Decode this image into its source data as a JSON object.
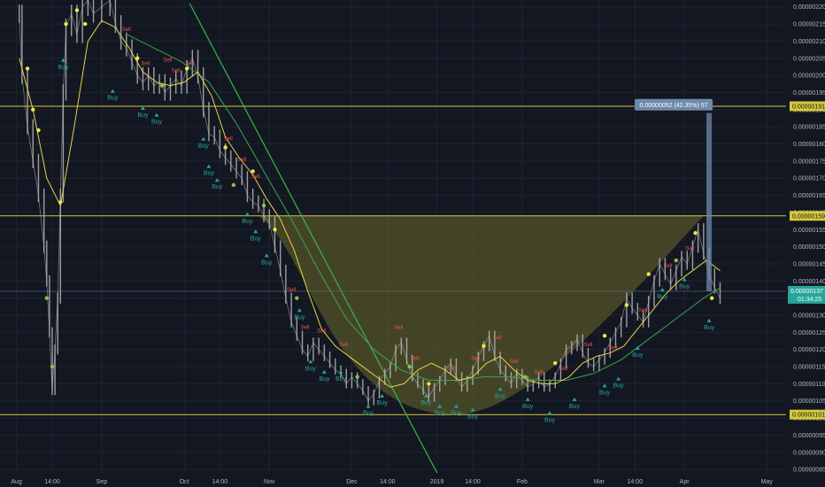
{
  "chart_data": {
    "type": "line",
    "price_axis": {
      "labels": [
        "0.00000220",
        "0.00000215",
        "0.00000210",
        "0.00000205",
        "0.00000200",
        "0.00000195",
        "0.00000190",
        "0.00000185",
        "0.00000180",
        "0.00000175",
        "0.00000170",
        "0.00000165",
        "0.00000160",
        "0.00000155",
        "0.00000150",
        "0.00000145",
        "0.00000140",
        "0.00000135",
        "0.00000130",
        "0.00000125",
        "0.00000120",
        "0.00000115",
        "0.00000110",
        "0.00000105",
        "0.00000100",
        "0.00000095",
        "0.00000090",
        "0.00000085"
      ],
      "ylim": [
        8.4e-07,
        2.22e-06
      ]
    },
    "time_axis": {
      "ticks": [
        {
          "day": 0,
          "label": "Aug"
        },
        {
          "day": 13,
          "label": "14:00"
        },
        {
          "day": 31,
          "label": "Sep"
        },
        {
          "day": 61,
          "label": "Oct"
        },
        {
          "day": 74,
          "label": "14:00"
        },
        {
          "day": 92,
          "label": "Nov"
        },
        {
          "day": 122,
          "label": "Dec"
        },
        {
          "day": 135,
          "label": "14:00"
        },
        {
          "day": 153,
          "label": "2019"
        },
        {
          "day": 166,
          "label": "14:00"
        },
        {
          "day": 184,
          "label": "Feb"
        },
        {
          "day": 212,
          "label": "Mar"
        },
        {
          "day": 225,
          "label": "14:00"
        },
        {
          "day": 243,
          "label": "Apr"
        },
        {
          "day": 273,
          "label": "May"
        }
      ]
    },
    "price_series": {
      "name": "",
      "x": [
        1,
        2,
        4,
        6,
        8,
        10,
        11,
        12,
        13,
        14,
        15,
        16,
        17,
        18,
        20,
        22,
        24,
        26,
        28,
        31,
        34,
        36,
        38,
        40,
        42,
        44,
        46,
        48,
        50,
        52,
        54,
        56,
        58,
        60,
        62,
        64,
        66,
        68,
        70,
        72,
        74,
        76,
        78,
        80,
        82,
        84,
        86,
        88,
        90,
        92,
        94,
        96,
        98,
        100,
        102,
        104,
        106,
        108,
        110,
        112,
        114,
        116,
        118,
        120,
        122,
        124,
        126,
        128,
        130,
        132,
        134,
        136,
        138,
        140,
        142,
        144,
        146,
        148,
        150,
        152,
        154,
        156,
        158,
        160,
        162,
        164,
        166,
        168,
        170,
        172,
        174,
        176,
        178,
        180,
        182,
        184,
        186,
        188,
        190,
        192,
        194,
        196,
        198,
        200,
        202,
        204,
        206,
        208,
        210,
        212,
        214,
        216,
        218,
        220,
        222,
        224,
        226,
        228,
        230,
        232,
        234,
        236,
        238,
        240,
        242,
        244,
        246,
        248,
        250,
        252,
        254,
        256
      ],
      "y": [
        2.18e-06,
        2e-06,
        1.85e-06,
        1.75e-06,
        1.65e-06,
        1.5e-06,
        1.4e-06,
        1.25e-06,
        1.08e-06,
        1.2e-06,
        1.35e-06,
        1.65e-06,
        1.95e-06,
        2.14e-06,
        2.18e-06,
        2.12e-06,
        2.2e-06,
        2.22e-06,
        2.18e-06,
        2.2e-06,
        2.22e-06,
        2.15e-06,
        2.1e-06,
        2.08e-06,
        2.04e-06,
        2e-06,
        1.98e-06,
        2e-06,
        1.97e-06,
        1.98e-06,
        1.95e-06,
        1.97e-06,
        1.99e-06,
        1.97e-06,
        2.02e-06,
        2.05e-06,
        2e-06,
        1.9e-06,
        1.83e-06,
        1.82e-06,
        1.78e-06,
        1.76e-06,
        1.74e-06,
        1.72e-06,
        1.7e-06,
        1.65e-06,
        1.63e-06,
        1.62e-06,
        1.59e-06,
        1.57e-06,
        1.5e-06,
        1.43e-06,
        1.35e-06,
        1.28e-06,
        1.24e-06,
        1.2e-06,
        1.18e-06,
        1.22e-06,
        1.2e-06,
        1.18e-06,
        1.16e-06,
        1.14e-06,
        1.13e-06,
        1.1e-06,
        1.12e-06,
        1.1e-06,
        1.08e-06,
        1.05e-06,
        1.07e-06,
        1.11e-06,
        1.13e-06,
        1.15e-06,
        1.2e-06,
        1.22e-06,
        1.17e-06,
        1.12e-06,
        1.1e-06,
        1.08e-06,
        1.06e-06,
        1.09e-06,
        1.11e-06,
        1.14e-06,
        1.16e-06,
        1.12e-06,
        1.09e-06,
        1.11e-06,
        1.14e-06,
        1.18e-06,
        1.21e-06,
        1.24e-06,
        1.18e-06,
        1.14e-06,
        1.12e-06,
        1.1e-06,
        1.13e-06,
        1.11e-06,
        1.09e-06,
        1.1e-06,
        1.12e-06,
        1.09e-06,
        1.1e-06,
        1.12e-06,
        1.16e-06,
        1.2e-06,
        1.21e-06,
        1.23e-06,
        1.19e-06,
        1.16e-06,
        1.15e-06,
        1.17e-06,
        1.19e-06,
        1.22e-06,
        1.25e-06,
        1.28e-06,
        1.35e-06,
        1.32e-06,
        1.3e-06,
        1.28e-06,
        1.34e-06,
        1.4e-06,
        1.45e-06,
        1.42e-06,
        1.39e-06,
        1.43e-06,
        1.47e-06,
        1.45e-06,
        1.5e-06,
        1.55e-06,
        1.48e-06,
        1.42e-06,
        1.38e-06,
        1.35e-06,
        1.32e-06
      ]
    },
    "ma_fast": {
      "name": "",
      "color": "#e8d24a",
      "x": [
        1,
        6,
        11,
        16,
        21,
        26,
        31,
        36,
        41,
        46,
        51,
        56,
        61,
        66,
        71,
        76,
        81,
        86,
        91,
        96,
        101,
        106,
        111,
        116,
        121,
        126,
        131,
        136,
        141,
        146,
        151,
        156,
        161,
        166,
        171,
        176,
        181,
        186,
        191,
        196,
        201,
        206,
        211,
        216,
        221,
        226,
        231,
        236,
        241,
        246,
        251,
        256
      ],
      "y": [
        2.05e-06,
        1.9e-06,
        1.7e-06,
        1.62e-06,
        1.85e-06,
        2.1e-06,
        2.16e-06,
        2.14e-06,
        2.08e-06,
        2.01e-06,
        1.98e-06,
        1.97e-06,
        1.98e-06,
        2.01e-06,
        1.94e-06,
        1.82e-06,
        1.76e-06,
        1.71e-06,
        1.64e-06,
        1.58e-06,
        1.49e-06,
        1.37e-06,
        1.26e-06,
        1.21e-06,
        1.18e-06,
        1.15e-06,
        1.12e-06,
        1.09e-06,
        1.1e-06,
        1.14e-06,
        1.16e-06,
        1.14e-06,
        1.11e-06,
        1.12e-06,
        1.16e-06,
        1.18e-06,
        1.14e-06,
        1.11e-06,
        1.1e-06,
        1.1e-06,
        1.12e-06,
        1.16e-06,
        1.18e-06,
        1.19e-06,
        1.21e-06,
        1.26e-06,
        1.31e-06,
        1.36e-06,
        1.4e-06,
        1.43e-06,
        1.46e-06,
        1.43e-06
      ]
    },
    "ma_slow": {
      "name": "",
      "color": "#3fa34d",
      "x": [
        40,
        50,
        60,
        70,
        80,
        90,
        100,
        110,
        120,
        130,
        140,
        150,
        160,
        170,
        180,
        190,
        200,
        210,
        220,
        230,
        240,
        250,
        256
      ],
      "y": [
        2.12e-06,
        2.08e-06,
        2.04e-06,
        1.98e-06,
        1.86e-06,
        1.72e-06,
        1.58e-06,
        1.43e-06,
        1.29e-06,
        1.2e-06,
        1.14e-06,
        1.11e-06,
        1.11e-06,
        1.12e-06,
        1.12e-06,
        1.11e-06,
        1.11e-06,
        1.13e-06,
        1.17e-06,
        1.23e-06,
        1.29e-06,
        1.35e-06,
        1.38e-06
      ]
    },
    "trendline": {
      "color": "#3bb54a",
      "points": [
        {
          "x": 63,
          "y": 2.21e-06
        },
        {
          "x": 153,
          "y": 8.4e-07
        }
      ]
    },
    "horizontal_levels": [
      {
        "value": 1.91e-06,
        "label": "0.00000191",
        "color": "#d4c93a"
      },
      {
        "value": 1.59e-06,
        "label": "0.00000159",
        "color": "#d4c93a"
      },
      {
        "value": 1.01e-06,
        "label": "0.00000101",
        "color": "#d4c93a"
      }
    ],
    "current_price": {
      "value": 1.37e-06,
      "label": "0.00000137",
      "sub_label": "01:34:25",
      "color": "#26a69a"
    },
    "reference_line": {
      "value": 1.37e-06,
      "color": "#5d6b7a"
    },
    "cup_pattern": {
      "fill_color": "#6b6a2a",
      "rim": 1.59e-06,
      "bottom": 1.01e-06,
      "x_start": 88,
      "x_bottom": 160,
      "x_end": 250
    },
    "measure_tool": {
      "label": "0.00000052 (42.35%) 57",
      "from": 1.37e-06,
      "to": 1.89e-06,
      "x": 252,
      "color": "#6e8aa8"
    },
    "signals": {
      "buy_label": "Buy",
      "sell_label": "Sell",
      "buy": [
        {
          "x": 17,
          "y": 2.05e-06
        },
        {
          "x": 35,
          "y": 1.96e-06
        },
        {
          "x": 46,
          "y": 1.91e-06
        },
        {
          "x": 51,
          "y": 1.89e-06
        },
        {
          "x": 68,
          "y": 1.82e-06
        },
        {
          "x": 70,
          "y": 1.74e-06
        },
        {
          "x": 73,
          "y": 1.7e-06
        },
        {
          "x": 84,
          "y": 1.6e-06
        },
        {
          "x": 87,
          "y": 1.55e-06
        },
        {
          "x": 91,
          "y": 1.48e-06
        },
        {
          "x": 103,
          "y": 1.32e-06
        },
        {
          "x": 107,
          "y": 1.17e-06
        },
        {
          "x": 112,
          "y": 1.14e-06
        },
        {
          "x": 118,
          "y": 1.14e-06
        },
        {
          "x": 128,
          "y": 1.04e-06
        },
        {
          "x": 133,
          "y": 1.07e-06
        },
        {
          "x": 149,
          "y": 1.07e-06
        },
        {
          "x": 154,
          "y": 1.04e-06
        },
        {
          "x": 160,
          "y": 1.04e-06
        },
        {
          "x": 166,
          "y": 1.03e-06
        },
        {
          "x": 176,
          "y": 1.09e-06
        },
        {
          "x": 186,
          "y": 1.06e-06
        },
        {
          "x": 194,
          "y": 1.02e-06
        },
        {
          "x": 203,
          "y": 1.06e-06
        },
        {
          "x": 214,
          "y": 1.1e-06
        },
        {
          "x": 219,
          "y": 1.12e-06
        },
        {
          "x": 226,
          "y": 1.21e-06
        },
        {
          "x": 235,
          "y": 1.38e-06
        },
        {
          "x": 243,
          "y": 1.41e-06
        },
        {
          "x": 252,
          "y": 1.29e-06
        }
      ],
      "sell": [
        {
          "x": 27,
          "y": 2.23e-06
        },
        {
          "x": 40,
          "y": 2.13e-06
        },
        {
          "x": 47,
          "y": 2.03e-06
        },
        {
          "x": 55,
          "y": 2.04e-06
        },
        {
          "x": 58,
          "y": 2.01e-06
        },
        {
          "x": 63,
          "y": 2.03e-06
        },
        {
          "x": 77,
          "y": 1.81e-06
        },
        {
          "x": 82,
          "y": 1.75e-06
        },
        {
          "x": 87,
          "y": 1.7e-06
        },
        {
          "x": 100,
          "y": 1.37e-06
        },
        {
          "x": 105,
          "y": 1.26e-06
        },
        {
          "x": 111,
          "y": 1.25e-06
        },
        {
          "x": 119,
          "y": 1.21e-06
        },
        {
          "x": 139,
          "y": 1.26e-06
        },
        {
          "x": 145,
          "y": 1.17e-06
        },
        {
          "x": 158,
          "y": 1.14e-06
        },
        {
          "x": 167,
          "y": 1.17e-06
        },
        {
          "x": 175,
          "y": 1.23e-06
        },
        {
          "x": 181,
          "y": 1.16e-06
        },
        {
          "x": 190,
          "y": 1.13e-06
        },
        {
          "x": 199,
          "y": 1.14e-06
        },
        {
          "x": 208,
          "y": 1.21e-06
        },
        {
          "x": 217,
          "y": 1.2e-06
        },
        {
          "x": 228,
          "y": 1.31e-06
        },
        {
          "x": 237,
          "y": 1.44e-06
        },
        {
          "x": 245,
          "y": 1.49e-06
        }
      ],
      "dots": [
        {
          "x": 4,
          "y": 2.02e-06,
          "color": "#e8e84a"
        },
        {
          "x": 6,
          "y": 1.9e-06,
          "color": "#e8e84a"
        },
        {
          "x": 8,
          "y": 1.84e-06,
          "color": "#e8e84a"
        },
        {
          "x": 11,
          "y": 1.35e-06,
          "color": "#8bc34a"
        },
        {
          "x": 13,
          "y": 1.15e-06,
          "color": "#8bc34a"
        },
        {
          "x": 16,
          "y": 1.63e-06,
          "color": "#e8e84a"
        },
        {
          "x": 18,
          "y": 2.15e-06,
          "color": "#e8e84a"
        },
        {
          "x": 22,
          "y": 2.19e-06,
          "color": "#e8e84a"
        },
        {
          "x": 25,
          "y": 2.15e-06,
          "color": "#e8e84a"
        },
        {
          "x": 44,
          "y": 2.05e-06,
          "color": "#e8e84a"
        },
        {
          "x": 53,
          "y": 1.97e-06,
          "color": "#8bc34a"
        },
        {
          "x": 62,
          "y": 2.02e-06,
          "color": "#e8e84a"
        },
        {
          "x": 76,
          "y": 1.79e-06,
          "color": "#e8e84a"
        },
        {
          "x": 79,
          "y": 1.68e-06,
          "color": "#8bc34a"
        },
        {
          "x": 86,
          "y": 1.72e-06,
          "color": "#e8e84a"
        },
        {
          "x": 90,
          "y": 1.62e-06,
          "color": "#8bc34a"
        },
        {
          "x": 94,
          "y": 1.55e-06,
          "color": "#e8e84a"
        },
        {
          "x": 102,
          "y": 1.35e-06,
          "color": "#8bc34a"
        },
        {
          "x": 124,
          "y": 1.12e-06,
          "color": "#8bc34a"
        },
        {
          "x": 143,
          "y": 1.15e-06,
          "color": "#8bc34a"
        },
        {
          "x": 150,
          "y": 1.1e-06,
          "color": "#e8e84a"
        },
        {
          "x": 170,
          "y": 1.21e-06,
          "color": "#e8e84a"
        },
        {
          "x": 185,
          "y": 1.12e-06,
          "color": "#8bc34a"
        },
        {
          "x": 196,
          "y": 1.16e-06,
          "color": "#e8e84a"
        },
        {
          "x": 214,
          "y": 1.24e-06,
          "color": "#e8e84a"
        },
        {
          "x": 222,
          "y": 1.33e-06,
          "color": "#e8e84a"
        },
        {
          "x": 230,
          "y": 1.42e-06,
          "color": "#e8e84a"
        },
        {
          "x": 240,
          "y": 1.46e-06,
          "color": "#8bc34a"
        },
        {
          "x": 247,
          "y": 1.54e-06,
          "color": "#e8e84a"
        },
        {
          "x": 253,
          "y": 1.35e-06,
          "color": "#e8e84a"
        }
      ]
    },
    "grid": true
  },
  "colors": {
    "background": "#131722",
    "grid": "#1e2330",
    "price_bars": "#b6b6b6"
  }
}
